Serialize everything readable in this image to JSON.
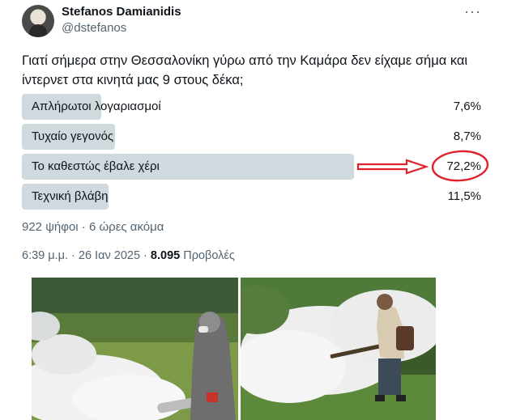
{
  "tweet": {
    "author_name": "Stefanos Damianidis",
    "author_handle": "@dstefanos",
    "more_icon": "···",
    "text": "Γιατί σήμερα στην Θεσσαλονίκη γύρω από την Καμάρα δεν είχαμε σήμα και ίντερνετ στα κινητά μας 9 στους δέκα;"
  },
  "poll": {
    "options": [
      {
        "label": "Απλήρωτοι λογαριασμοί",
        "percent": "7,6%",
        "value": 7.6
      },
      {
        "label": "Τυχαίο γεγονός",
        "percent": "8,7%",
        "value": 8.7
      },
      {
        "label": "Το καθεστώς έβαλε χέρι",
        "percent": "72,2%",
        "value": 72.2
      },
      {
        "label": "Τεχνική βλάβη",
        "percent": "11,5%",
        "value": 11.5
      }
    ],
    "votes_line": "922 ψήφοι · 6 ώρες ακόμα"
  },
  "meta": {
    "time": "6:39 μ.μ. · 26 Ιαν 2025 · ",
    "views_count": "8.095",
    "views_label": " Προβολές"
  },
  "annotation": {
    "color": "#e0202a"
  }
}
